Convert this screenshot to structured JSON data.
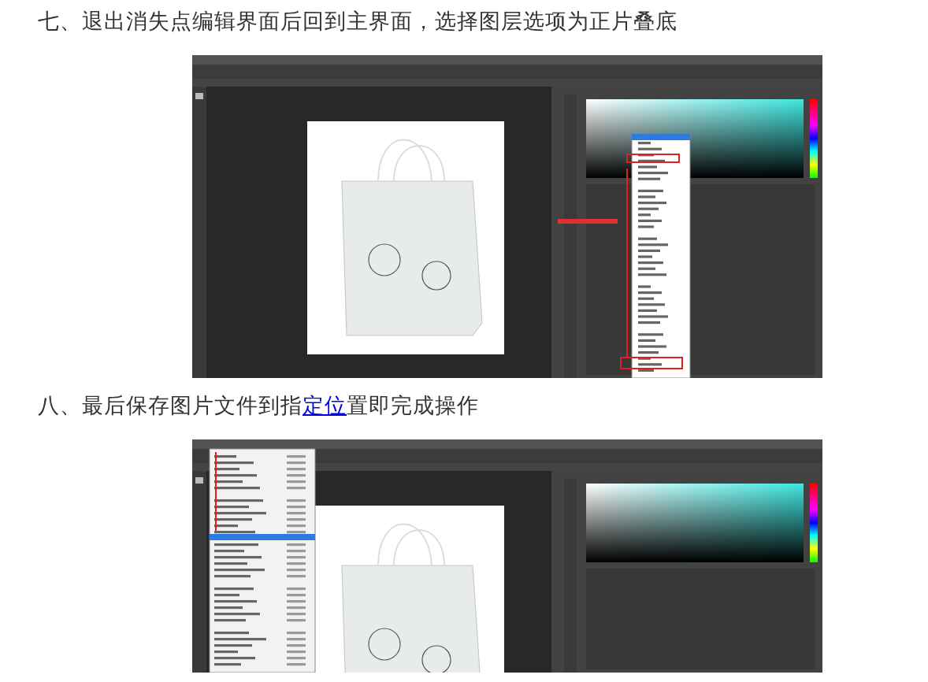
{
  "steps": [
    {
      "kind": "blend-mode-menu",
      "parts": [
        {
          "text": "七、退出消失点编辑界面后回到主界面，选择图层选项为正片叠底",
          "link": false
        }
      ]
    },
    {
      "kind": "file-menu",
      "parts": [
        {
          "text": "八、最后保存图片文件到指",
          "link": false
        },
        {
          "text": "定位",
          "link": true
        },
        {
          "text": "置即完成操作",
          "link": false
        }
      ]
    }
  ]
}
